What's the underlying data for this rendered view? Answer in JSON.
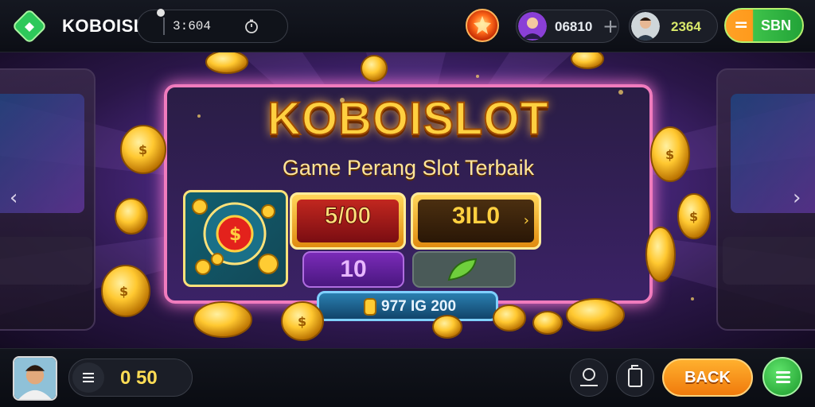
{
  "header": {
    "brand": "KOBOISLOT",
    "search_value": "3:604",
    "icons": [
      "logo-diamond-icon",
      "timer-icon",
      "fire-orb-icon",
      "avatar-icon",
      "plus-icon"
    ],
    "points": "06810",
    "player_score": "2364",
    "deposit_label": "SBN"
  },
  "hero": {
    "title": "KOBOISLOT",
    "subtitle": "Game Perang Slot Terbaik",
    "bet_a": "5/00",
    "bet_b": "3IL0",
    "level": "10",
    "jackpot": "977 IG 200",
    "nav_prev": "‹",
    "nav_next": "›"
  },
  "footer": {
    "balance": "0 50",
    "back_label": "BACK",
    "icons": [
      "menu-icon",
      "user-icon",
      "card-icon",
      "hamburger-icon"
    ]
  },
  "colors": {
    "accent_gold": "#ffd040",
    "panel_border": "#f07bbd",
    "green_button": "#22a338",
    "orange_button": "#ff9a1c"
  }
}
